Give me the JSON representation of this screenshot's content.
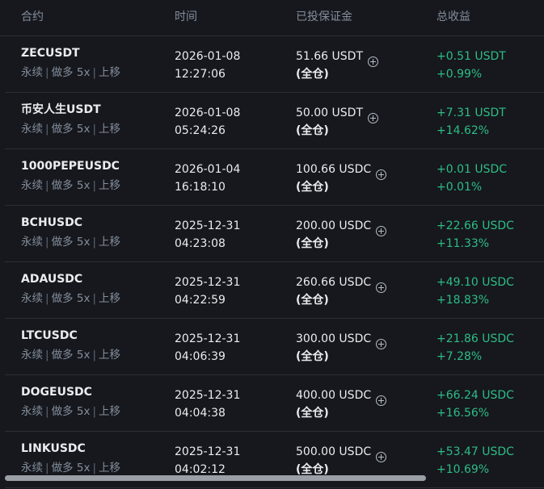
{
  "header": {
    "contract": "合约",
    "time": "时间",
    "margin": "已投保证金",
    "pnl": "总收益"
  },
  "rows": [
    {
      "symbol": "ZECUSDT",
      "type": "永续",
      "side": "做多",
      "leverage": "5x",
      "action": "上移",
      "date": "2026-01-08",
      "time": "12:27:06",
      "margin": "51.66 USDT",
      "mode": "(全仓)",
      "pnl": "+0.51 USDT",
      "pnl_pct": "+0.99%"
    },
    {
      "symbol": "币安人生USDT",
      "type": "永续",
      "side": "做多",
      "leverage": "5x",
      "action": "上移",
      "date": "2026-01-08",
      "time": "05:24:26",
      "margin": "50.00 USDT",
      "mode": "(全仓)",
      "pnl": "+7.31 USDT",
      "pnl_pct": "+14.62%"
    },
    {
      "symbol": "1000PEPEUSDC",
      "type": "永续",
      "side": "做多",
      "leverage": "5x",
      "action": "上移",
      "date": "2026-01-04",
      "time": "16:18:10",
      "margin": "100.66 USDC",
      "mode": "(全仓)",
      "pnl": "+0.01 USDC",
      "pnl_pct": "+0.01%"
    },
    {
      "symbol": "BCHUSDC",
      "type": "永续",
      "side": "做多",
      "leverage": "5x",
      "action": "上移",
      "date": "2025-12-31",
      "time": "04:23:08",
      "margin": "200.00 USDC",
      "mode": "(全仓)",
      "pnl": "+22.66 USDC",
      "pnl_pct": "+11.33%"
    },
    {
      "symbol": "ADAUSDC",
      "type": "永续",
      "side": "做多",
      "leverage": "5x",
      "action": "上移",
      "date": "2025-12-31",
      "time": "04:22:59",
      "margin": "260.66 USDC",
      "mode": "(全仓)",
      "pnl": "+49.10 USDC",
      "pnl_pct": "+18.83%"
    },
    {
      "symbol": "LTCUSDC",
      "type": "永续",
      "side": "做多",
      "leverage": "5x",
      "action": "上移",
      "date": "2025-12-31",
      "time": "04:06:39",
      "margin": "300.00 USDC",
      "mode": "(全仓)",
      "pnl": "+21.86 USDC",
      "pnl_pct": "+7.28%"
    },
    {
      "symbol": "DOGEUSDC",
      "type": "永续",
      "side": "做多",
      "leverage": "5x",
      "action": "上移",
      "date": "2025-12-31",
      "time": "04:04:38",
      "margin": "400.00 USDC",
      "mode": "(全仓)",
      "pnl": "+66.24 USDC",
      "pnl_pct": "+16.56%"
    },
    {
      "symbol": "LINKUSDC",
      "type": "永续",
      "side": "做多",
      "leverage": "5x",
      "action": "上移",
      "date": "2025-12-31",
      "time": "04:02:12",
      "margin": "500.00 USDC",
      "mode": "(全仓)",
      "pnl": "+53.47 USDC",
      "pnl_pct": "+10.69%"
    }
  ],
  "icons": {
    "add_margin": "plus-circle-icon"
  },
  "colors": {
    "background": "#16181d",
    "profit": "#2ebd85",
    "muted": "#848e9c",
    "text": "#eaecef"
  }
}
